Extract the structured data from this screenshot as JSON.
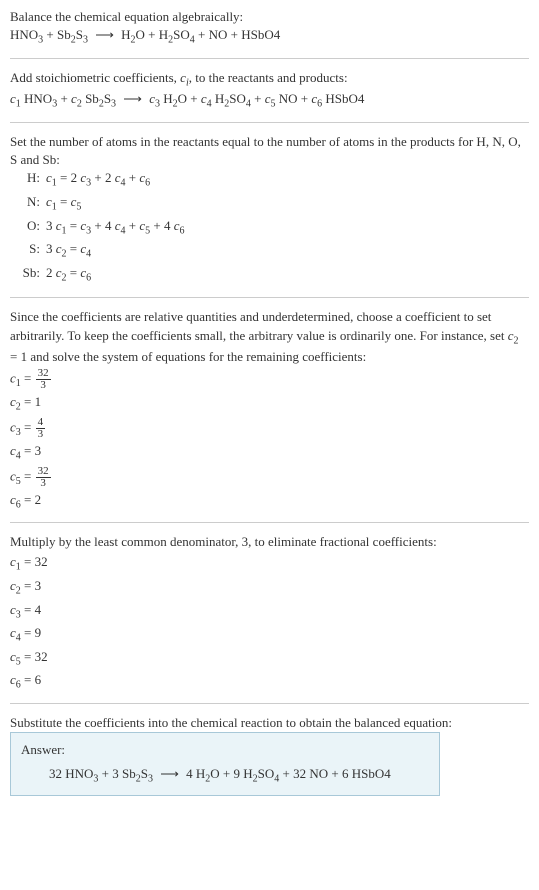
{
  "intro": {
    "line1": "Balance the chemical equation algebraically:",
    "eq_left_1": "HNO",
    "eq_left_1_sub": "3",
    "plus1": " + ",
    "eq_left_2a": "Sb",
    "eq_left_2a_sub": "2",
    "eq_left_2b": "S",
    "eq_left_2b_sub": "3",
    "arrow": "⟶",
    "eq_r1a": "H",
    "eq_r1a_sub": "2",
    "eq_r1b": "O",
    "plus2": " + ",
    "eq_r2a": "H",
    "eq_r2a_sub": "2",
    "eq_r2b": "SO",
    "eq_r2b_sub": "4",
    "plus3": " + ",
    "eq_r3": "NO",
    "plus4": " + ",
    "eq_r4": "HSbO4"
  },
  "stoich": {
    "line1": "Add stoichiometric coefficients, ",
    "ci": "c",
    "ci_sub": "i",
    "line1b": ", to the reactants and products:",
    "c1": "c",
    "c1s": "1",
    "t1": " HNO",
    "t1s": "3",
    "plus1": " + ",
    "c2": "c",
    "c2s": "2",
    "t2a": " Sb",
    "t2as": "2",
    "t2b": "S",
    "t2bs": "3",
    "arrow": "⟶",
    "c3": "c",
    "c3s": "3",
    "t3a": " H",
    "t3as": "2",
    "t3b": "O",
    "plus2": " + ",
    "c4": "c",
    "c4s": "4",
    "t4a": " H",
    "t4as": "2",
    "t4b": "SO",
    "t4bs": "4",
    "plus3": " + ",
    "c5": "c",
    "c5s": "5",
    "t5": " NO",
    "plus4": " + ",
    "c6": "c",
    "c6s": "6",
    "t6": " HSbO4"
  },
  "atoms_intro": "Set the number of atoms in the reactants equal to the number of atoms in the products for H, N, O, S and Sb:",
  "atoms": {
    "H": {
      "lbl": "H:",
      "eq_a": "c",
      "eq_as": "1",
      "eq_b": " = 2 ",
      "eq_c": "c",
      "eq_cs": "3",
      "eq_d": " + 2 ",
      "eq_e": "c",
      "eq_es": "4",
      "eq_f": " + ",
      "eq_g": "c",
      "eq_gs": "6"
    },
    "N": {
      "lbl": "N:",
      "eq_a": "c",
      "eq_as": "1",
      "eq_b": " = ",
      "eq_c": "c",
      "eq_cs": "5"
    },
    "O": {
      "lbl": "O:",
      "eq_a": "3 ",
      "eq_b": "c",
      "eq_bs": "1",
      "eq_c": " = ",
      "eq_d": "c",
      "eq_ds": "3",
      "eq_e": " + 4 ",
      "eq_f": "c",
      "eq_fs": "4",
      "eq_g": " + ",
      "eq_h": "c",
      "eq_hs": "5",
      "eq_i": " + 4 ",
      "eq_j": "c",
      "eq_js": "6"
    },
    "S": {
      "lbl": "S:",
      "eq_a": "3 ",
      "eq_b": "c",
      "eq_bs": "2",
      "eq_c": " = ",
      "eq_d": "c",
      "eq_ds": "4"
    },
    "Sb": {
      "lbl": "Sb:",
      "eq_a": "2 ",
      "eq_b": "c",
      "eq_bs": "2",
      "eq_c": " = ",
      "eq_d": "c",
      "eq_ds": "6"
    }
  },
  "solve_intro_a": "Since the coefficients are relative quantities and underdetermined, choose a coefficient to set arbitrarily. To keep the coefficients small, the arbitrary value is ordinarily one. For instance, set ",
  "solve_c2": "c",
  "solve_c2s": "2",
  "solve_eq": " = 1",
  "solve_intro_b": " and solve the system of equations for the remaining coefficients:",
  "solve": {
    "r1": {
      "c": "c",
      "s": "1",
      "eq": " = ",
      "num": "32",
      "den": "3"
    },
    "r2": {
      "c": "c",
      "s": "2",
      "eq": " = 1"
    },
    "r3": {
      "c": "c",
      "s": "3",
      "eq": " = ",
      "num": "4",
      "den": "3"
    },
    "r4": {
      "c": "c",
      "s": "4",
      "eq": " = 3"
    },
    "r5": {
      "c": "c",
      "s": "5",
      "eq": " = ",
      "num": "32",
      "den": "3"
    },
    "r6": {
      "c": "c",
      "s": "6",
      "eq": " = 2"
    }
  },
  "mult_intro": "Multiply by the least common denominator, 3, to eliminate fractional coefficients:",
  "mult": {
    "r1": {
      "c": "c",
      "s": "1",
      "eq": " = 32"
    },
    "r2": {
      "c": "c",
      "s": "2",
      "eq": " = 3"
    },
    "r3": {
      "c": "c",
      "s": "3",
      "eq": " = 4"
    },
    "r4": {
      "c": "c",
      "s": "4",
      "eq": " = 9"
    },
    "r5": {
      "c": "c",
      "s": "5",
      "eq": " = 32"
    },
    "r6": {
      "c": "c",
      "s": "6",
      "eq": " = 6"
    }
  },
  "sub_intro": "Substitute the coefficients into the chemical reaction to obtain the balanced equation:",
  "answer": {
    "label": "Answer:",
    "n1": "32 ",
    "t1": "HNO",
    "t1s": "3",
    "plus1": " + ",
    "n2": "3 ",
    "t2a": "Sb",
    "t2as": "2",
    "t2b": "S",
    "t2bs": "3",
    "arrow": "⟶",
    "n3": "4 ",
    "t3a": "H",
    "t3as": "2",
    "t3b": "O",
    "plus2": " + ",
    "n4": "9 ",
    "t4a": "H",
    "t4as": "2",
    "t4b": "SO",
    "t4bs": "4",
    "plus3": " + ",
    "n5": "32 ",
    "t5": "NO",
    "plus4": " + ",
    "n6": "6 ",
    "t6": "HSbO4"
  }
}
